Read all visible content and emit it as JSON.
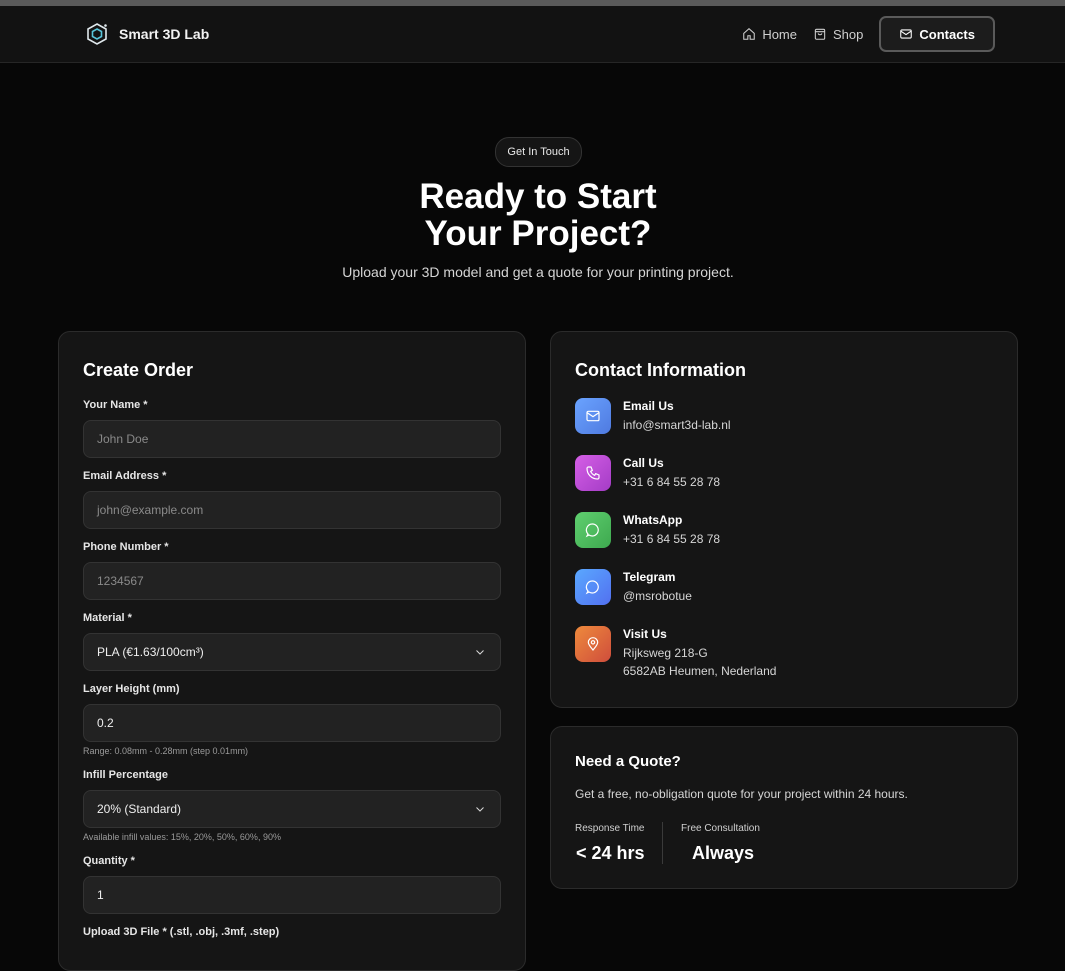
{
  "header": {
    "brand": "Smart 3D Lab",
    "nav": [
      {
        "label": "Home",
        "icon": "home-icon"
      },
      {
        "label": "Shop",
        "icon": "bag-icon"
      },
      {
        "label": "Contacts",
        "icon": "mail-icon"
      }
    ]
  },
  "hero": {
    "badge": "Get In Touch",
    "title_line1": "Ready to Start",
    "title_line2": "Your Project?",
    "subtitle": "Upload your 3D model and get a quote for your printing project."
  },
  "order": {
    "title": "Create Order",
    "name_label": "Your Name *",
    "name_placeholder": "John Doe",
    "email_label": "Email Address *",
    "email_placeholder": "john@example.com",
    "phone_label": "Phone Number *",
    "phone_placeholder": "1234567",
    "material_label": "Material *",
    "material_value": "PLA (€1.63/100cm³)",
    "layer_label": "Layer Height (mm)",
    "layer_value": "0.2",
    "layer_hint": "Range: 0.08mm - 0.28mm (step 0.01mm)",
    "infill_label": "Infill Percentage",
    "infill_value": "20% (Standard)",
    "infill_hint": "Available infill values: 15%, 20%, 50%, 60%, 90%",
    "quantity_label": "Quantity *",
    "quantity_value": "1",
    "upload_label": "Upload 3D File * (.stl, .obj, .3mf, .step)"
  },
  "contact": {
    "title": "Contact Information",
    "items": [
      {
        "title": "Email Us",
        "lines": [
          "info@smart3d-lab.nl"
        ],
        "icon": "mail-icon",
        "color": "#5b8def"
      },
      {
        "title": "Call Us",
        "lines": [
          "+31 6 84 55 28 78"
        ],
        "icon": "phone-icon",
        "color": "#c04fd8"
      },
      {
        "title": "WhatsApp",
        "lines": [
          "+31 6 84 55 28 78"
        ],
        "icon": "chat-icon",
        "color": "#4cbb5a"
      },
      {
        "title": "Telegram",
        "lines": [
          "@msrobotue"
        ],
        "icon": "chat-icon",
        "color": "#4a7ef0"
      },
      {
        "title": "Visit Us",
        "lines": [
          "Rijksweg 218-G",
          "6582AB Heumen, Nederland"
        ],
        "icon": "map-pin-icon",
        "color": "#d8653a"
      }
    ]
  },
  "quote": {
    "title": "Need a Quote?",
    "description": "Get a free, no-obligation quote for your project within 24 hours.",
    "stat1_label": "Response Time",
    "stat1_value": "< 24 hrs",
    "stat2_label": "Free Consultation",
    "stat2_value": "Always"
  }
}
